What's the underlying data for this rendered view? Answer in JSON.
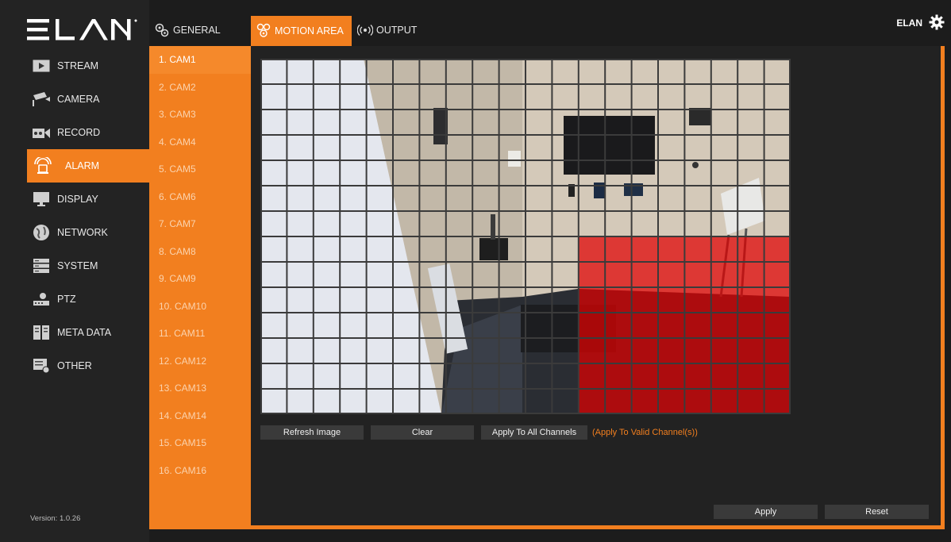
{
  "brand": {
    "logo_text": "ELAN",
    "accent": "#f27f1f",
    "motion_color": "#e00000"
  },
  "sidebar": {
    "items": [
      {
        "label": "STREAM",
        "icon": "play-icon",
        "active": false
      },
      {
        "label": "CAMERA",
        "icon": "camera-icon",
        "active": false
      },
      {
        "label": "RECORD",
        "icon": "record-icon",
        "active": false
      },
      {
        "label": "ALARM",
        "icon": "alarm-icon",
        "active": true
      },
      {
        "label": "DISPLAY",
        "icon": "monitor-icon",
        "active": false
      },
      {
        "label": "NETWORK",
        "icon": "globe-icon",
        "active": false
      },
      {
        "label": "SYSTEM",
        "icon": "server-icon",
        "active": false
      },
      {
        "label": "PTZ",
        "icon": "ptz-icon",
        "active": false
      },
      {
        "label": "META DATA",
        "icon": "metadata-icon",
        "active": false
      },
      {
        "label": "OTHER",
        "icon": "other-icon",
        "active": false
      }
    ],
    "version": "Version: 1.0.26"
  },
  "topbar": {
    "tabs": [
      {
        "label": "GENERAL",
        "icon": "gears-icon",
        "active": false
      },
      {
        "label": "MOTION AREA",
        "icon": "motion-area-icon",
        "active": true
      },
      {
        "label": "OUTPUT",
        "icon": "broadcast-icon",
        "active": false
      }
    ],
    "user": "ELAN"
  },
  "channels": [
    "1. CAM1",
    "2. CAM2",
    "3. CAM3",
    "4. CAM4",
    "5. CAM5",
    "6. CAM6",
    "7. CAM7",
    "8. CAM8",
    "9. CAM9",
    "10. CAM10",
    "11. CAM11",
    "12. CAM12",
    "13. CAM13",
    "14. CAM14",
    "15. CAM15",
    "16. CAM16"
  ],
  "selected_channel": 0,
  "motion_grid": {
    "columns": 20,
    "rows": 14,
    "selected_region": {
      "col_start": 12,
      "col_end": 19,
      "row_start": 7,
      "row_end": 13
    }
  },
  "actions": {
    "refresh": "Refresh Image",
    "clear": "Clear",
    "apply_all": "Apply To All Channels",
    "apply_note": "(Apply To Valid Channel(s))",
    "apply": "Apply",
    "reset": "Reset"
  }
}
